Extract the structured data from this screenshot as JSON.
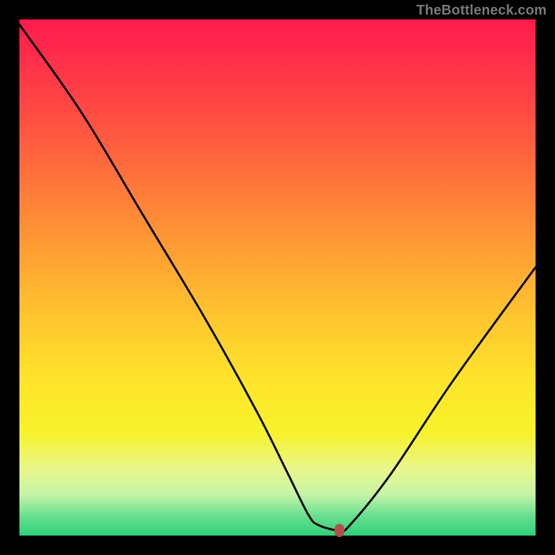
{
  "source_label": "TheBottleneck.com",
  "chart_data": {
    "type": "line",
    "title": "",
    "xlabel": "",
    "ylabel": "",
    "xlim": [
      0,
      100
    ],
    "ylim": [
      0,
      100
    ],
    "grid": false,
    "axes_visible": false,
    "series": [
      {
        "name": "bottleneck-curve",
        "x": [
          0,
          12,
          24,
          36,
          46,
          52,
          56,
          58,
          62,
          64,
          72,
          84,
          100
        ],
        "values": [
          99,
          82,
          62,
          42,
          24,
          12,
          4,
          2,
          1,
          2,
          12,
          30,
          52
        ]
      }
    ],
    "marker": {
      "x": 62,
      "y": 1,
      "color": "#b05048"
    },
    "gradient_stops": [
      {
        "pct": 0,
        "color": "#ff1a4d"
      },
      {
        "pct": 8,
        "color": "#ff2f4a"
      },
      {
        "pct": 20,
        "color": "#ff5142"
      },
      {
        "pct": 33,
        "color": "#ff7a3a"
      },
      {
        "pct": 46,
        "color": "#ffa233"
      },
      {
        "pct": 58,
        "color": "#ffc62e"
      },
      {
        "pct": 70,
        "color": "#ffe42b"
      },
      {
        "pct": 80,
        "color": "#f7f22a"
      },
      {
        "pct": 87,
        "color": "#e9f68a"
      },
      {
        "pct": 92,
        "color": "#c6f4a6"
      },
      {
        "pct": 96,
        "color": "#6be090"
      },
      {
        "pct": 100,
        "color": "#2fd07a"
      }
    ]
  }
}
